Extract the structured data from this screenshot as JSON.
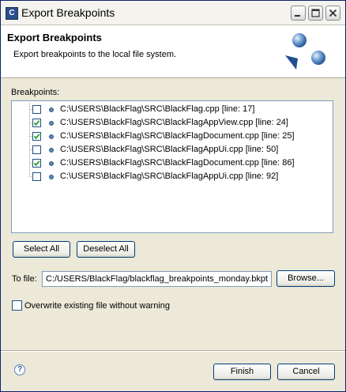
{
  "window": {
    "title": "Export Breakpoints",
    "app_icon": "C",
    "controls": [
      "minimize-icon",
      "maximize-icon",
      "close-icon"
    ]
  },
  "banner": {
    "title": "Export Breakpoints",
    "description": "Export breakpoints to the local file system.",
    "image": "export-wizard-icon"
  },
  "breakpoints": {
    "label": "Breakpoints:",
    "items": [
      {
        "text": "C:\\USERS\\BlackFlag\\SRC\\BlackFlag.cpp [line: 17]",
        "checked": false
      },
      {
        "text": "C:\\USERS\\BlackFlag\\SRC\\BlackFlagAppView.cpp [line: 24]",
        "checked": true
      },
      {
        "text": "C:\\USERS\\BlackFlag\\SRC\\BlackFlagDocument.cpp [line: 25]",
        "checked": true
      },
      {
        "text": "C:\\USERS\\BlackFlag\\SRC\\BlackFlagAppUi.cpp [line: 50]",
        "checked": false
      },
      {
        "text": "C:\\USERS\\BlackFlag\\SRC\\BlackFlagDocument.cpp [line: 86]",
        "checked": true
      },
      {
        "text": "C:\\USERS\\BlackFlag\\SRC\\BlackFlagAppUi.cpp [line: 92]",
        "checked": false
      }
    ]
  },
  "buttons": {
    "select_all": "Select All",
    "deselect_all": "Deselect All",
    "browse": "Browse...",
    "finish": "Finish",
    "cancel": "Cancel"
  },
  "to_file": {
    "label": "To file:",
    "value": "C:/USERS/BlackFlag/blackflag_breakpoints_monday.bkpt"
  },
  "overwrite": {
    "label": "Overwrite existing file without warning",
    "checked": false
  },
  "help": {
    "icon": "help-icon",
    "glyph": "?"
  },
  "colors": {
    "dialog_bg": "#ece9d8",
    "banner_bg": "#ffffff",
    "checkmark": "#21a121",
    "breakpoint_dot": "#5b86b4"
  }
}
